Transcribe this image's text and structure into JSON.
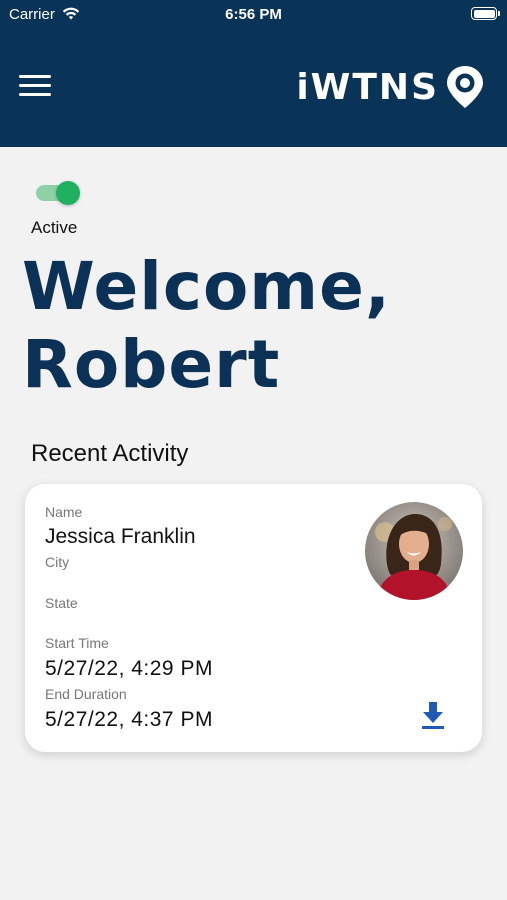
{
  "status_bar": {
    "carrier": "Carrier",
    "time": "6:56 PM"
  },
  "header": {
    "logo_text": "iWTNS",
    "background_color": "#0a3358",
    "icons": [
      "menu-icon",
      "eye-pin-icon"
    ]
  },
  "toggle": {
    "state": "on",
    "label": "Active",
    "color": "#1fb160"
  },
  "welcome": {
    "line1": "Welcome,",
    "line2": "Robert"
  },
  "recent_activity": {
    "title": "Recent Activity",
    "card": {
      "name_label": "Name",
      "name_value": "Jessica Franklin",
      "city_label": "City",
      "state_label": "State",
      "start_label": "Start Time",
      "start_value": "5/27/22, 4:29 PM",
      "end_label": "End Duration",
      "end_value": "5/27/22, 4:37 PM",
      "download_icon": "download-icon",
      "accent_color": "#1f5bb5"
    }
  }
}
